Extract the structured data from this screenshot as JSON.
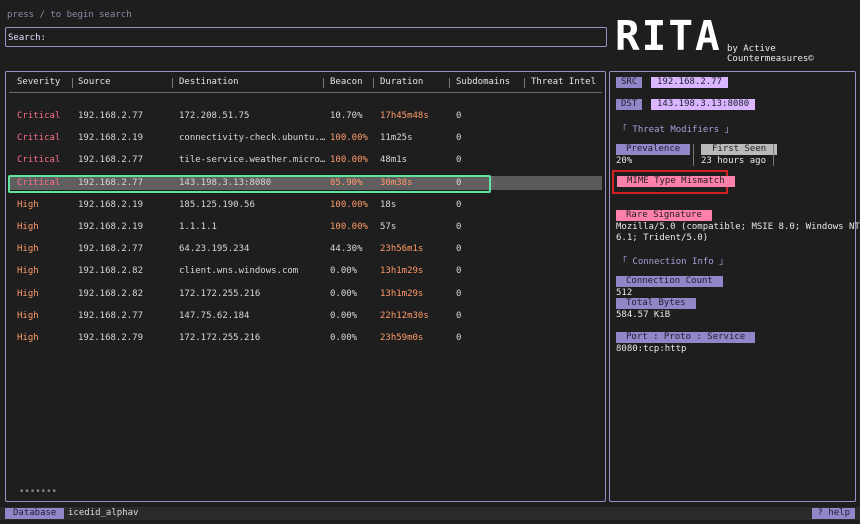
{
  "hint": "press / to begin search",
  "search": {
    "label": "Search:",
    "value": ""
  },
  "logo": {
    "text": "RITA",
    "subtitle": "by Active Countermeasures©"
  },
  "table": {
    "columns": [
      "Severity",
      "Source",
      "Destination",
      "Beacon",
      "Duration",
      "Subdomains",
      "Threat Intel"
    ],
    "rows": [
      {
        "severity": "Critical",
        "source": "192.168.2.77",
        "destination": "172.208.51.75",
        "beacon": "10.70%",
        "duration": "17h45m48s",
        "subdomains": "0",
        "beacon_hi": false,
        "dur_hi": true
      },
      {
        "severity": "Critical",
        "source": "192.168.2.19",
        "destination": "connectivity-check.ubuntu.…",
        "beacon": "100.00%",
        "duration": "11m25s",
        "subdomains": "0",
        "beacon_hi": true,
        "dur_hi": false
      },
      {
        "severity": "Critical",
        "source": "192.168.2.77",
        "destination": "tile-service.weather.micro…",
        "beacon": "100.00%",
        "duration": "48m1s",
        "subdomains": "0",
        "beacon_hi": true,
        "dur_hi": false
      },
      {
        "severity": "Critical",
        "source": "192.168.2.77",
        "destination": "143.198.3.13:8080",
        "beacon": "85.90%",
        "duration": "30m38s",
        "subdomains": "0",
        "beacon_hi": true,
        "dur_hi": true,
        "selected": true
      },
      {
        "severity": "High",
        "source": "192.168.2.19",
        "destination": "185.125.190.56",
        "beacon": "100.00%",
        "duration": "18s",
        "subdomains": "0",
        "beacon_hi": true,
        "dur_hi": false
      },
      {
        "severity": "High",
        "source": "192.168.2.19",
        "destination": "1.1.1.1",
        "beacon": "100.00%",
        "duration": "57s",
        "subdomains": "0",
        "beacon_hi": true,
        "dur_hi": false
      },
      {
        "severity": "High",
        "source": "192.168.2.77",
        "destination": "64.23.195.234",
        "beacon": "44.30%",
        "duration": "23h56m1s",
        "subdomains": "0",
        "beacon_hi": false,
        "dur_hi": true
      },
      {
        "severity": "High",
        "source": "192.168.2.82",
        "destination": "client.wns.windows.com",
        "beacon": "0.00%",
        "duration": "13h1m29s",
        "subdomains": "0",
        "beacon_hi": false,
        "dur_hi": true
      },
      {
        "severity": "High",
        "source": "192.168.2.82",
        "destination": "172.172.255.216",
        "beacon": "0.00%",
        "duration": "13h1m29s",
        "subdomains": "0",
        "beacon_hi": false,
        "dur_hi": true
      },
      {
        "severity": "High",
        "source": "192.168.2.77",
        "destination": "147.75.62.184",
        "beacon": "0.00%",
        "duration": "22h12m30s",
        "subdomains": "0",
        "beacon_hi": false,
        "dur_hi": true
      },
      {
        "severity": "High",
        "source": "192.168.2.79",
        "destination": "172.172.255.216",
        "beacon": "0.00%",
        "duration": "23h59m0s",
        "subdomains": "0",
        "beacon_hi": false,
        "dur_hi": true
      }
    ],
    "pager": "•••••••"
  },
  "detail": {
    "src_label": "SRC",
    "src_value": "192.168.2.77",
    "dst_label": "DST",
    "dst_value": "143.198.3.13:8080",
    "threat_modifiers_title": "「 Threat Modifiers 」",
    "prevalence_label": "Prevalence",
    "prevalence_value": "20%",
    "first_seen_label": "First Seen",
    "first_seen_value": "23 hours ago",
    "mime_mismatch": "MIME Type Mismatch",
    "rare_signature_label": "Rare Signature",
    "rare_signature_value_1": "Mozilla/5.0 (compatible; MSIE 8.0; Windows NT",
    "rare_signature_value_2": "6.1; Trident/5.0)",
    "connection_info_title": "「 Connection Info 」",
    "connection_count_label": "Connection Count",
    "connection_count_value": "512",
    "total_bytes_label": "Total Bytes",
    "total_bytes_value": "584.57 KiB",
    "port_label": "Port : Proto : Service",
    "port_value": "8080:tcp:http"
  },
  "status": {
    "db_label": "Database",
    "db_name": "icedid_alphav",
    "help": "? help"
  },
  "colors": {
    "accent": "#9286c8",
    "critical": "#ff6f8a",
    "high": "#ff9a6a",
    "selection": "#5ee5a0"
  }
}
